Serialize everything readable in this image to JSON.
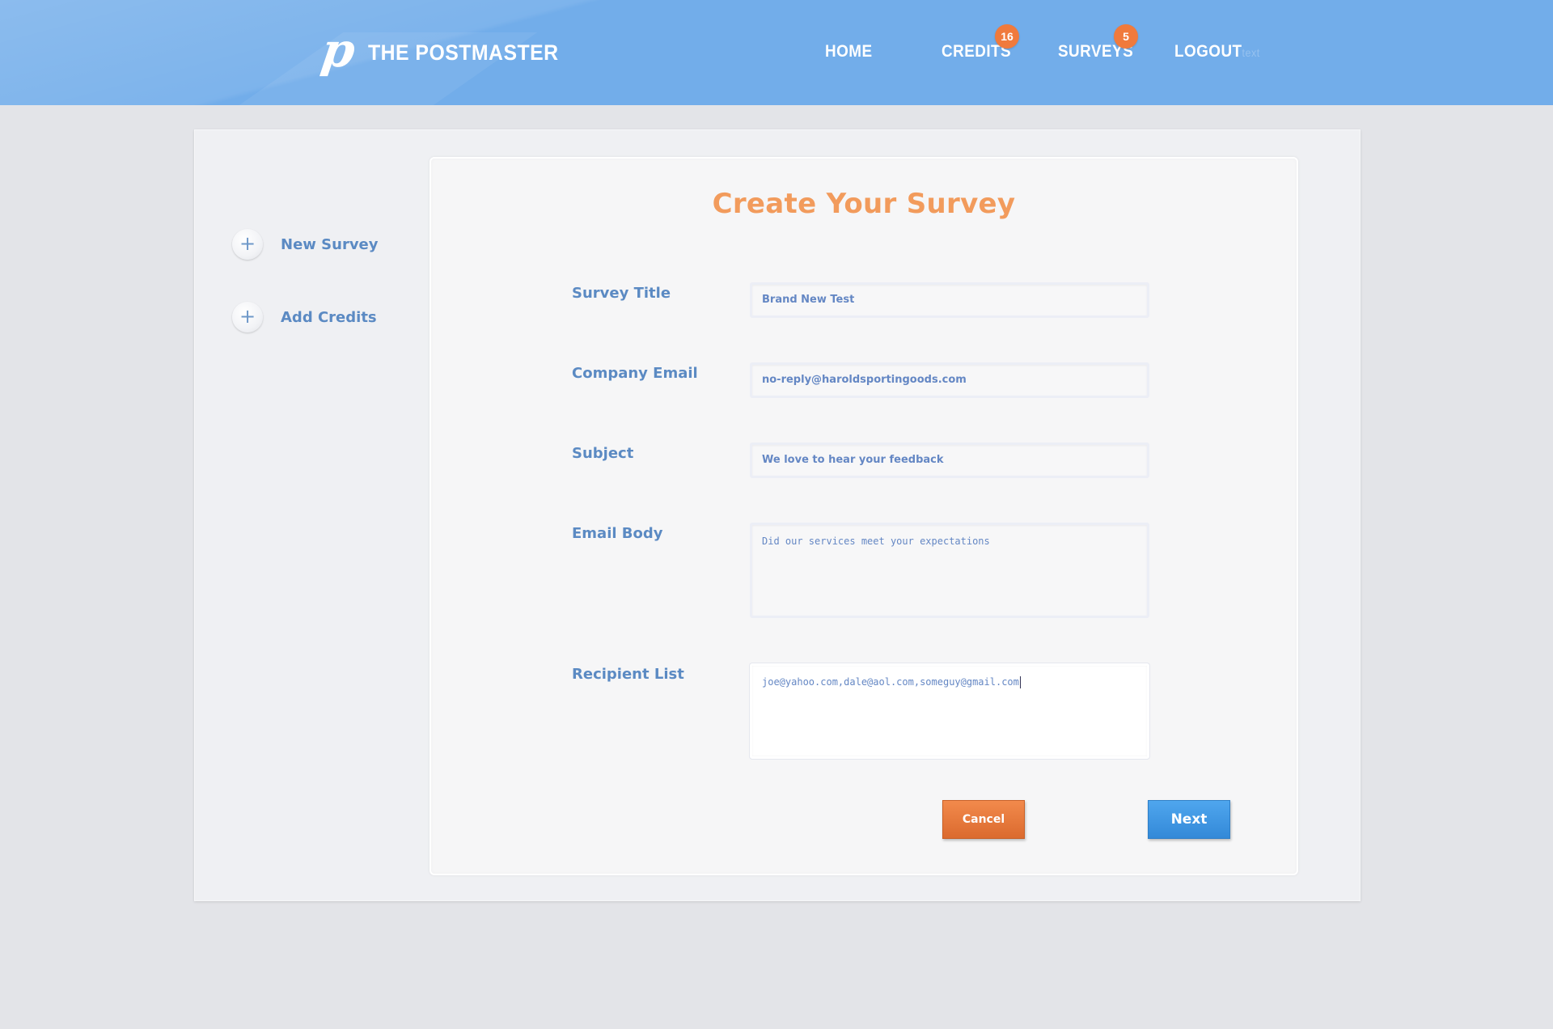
{
  "header": {
    "logo_mark": "p",
    "brand": "THE POSTMASTER",
    "nav": [
      {
        "label": "HOME"
      },
      {
        "label": "CREDITS",
        "badge": "16"
      },
      {
        "label": "SURVEYS",
        "badge": "5"
      },
      {
        "label": "LOGOUT",
        "suffix": "text"
      }
    ]
  },
  "sidebar": {
    "items": [
      {
        "icon": "+",
        "label": "New Survey"
      },
      {
        "icon": "+",
        "label": "Add Credits"
      }
    ]
  },
  "form": {
    "title": "Create Your Survey",
    "survey_title": {
      "label": "Survey Title",
      "value": "Brand New Test"
    },
    "company_email": {
      "label": "Company Email",
      "value": "no-reply@haroldsportingoods.com"
    },
    "subject": {
      "label": "Subject",
      "value": "We love to hear your feedback"
    },
    "email_body": {
      "label": "Email Body",
      "value": "Did our services  meet your expectations"
    },
    "recipient_list": {
      "label": "Recipient List",
      "value": "joe@yahoo.com,dale@aol.com,someguy@gmail.com"
    },
    "cancel_label": "Cancel",
    "next_label": "Next"
  },
  "colors": {
    "header_bg": "#72adea",
    "badge": "#f07a3c",
    "title": "#f29b5c",
    "label": "#5b8ac3",
    "cancel": "#e27433",
    "next": "#3d95e2"
  },
  "icons": [
    "logo-p-icon",
    "plus-icon"
  ]
}
